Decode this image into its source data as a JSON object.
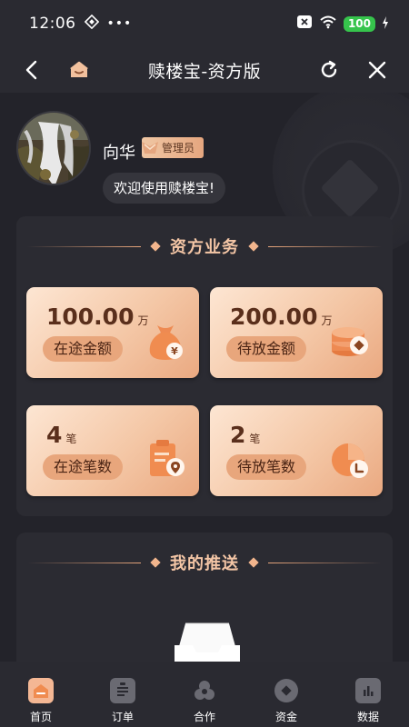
{
  "status_bar": {
    "time": "12:06",
    "battery": "100"
  },
  "header": {
    "title": "赎楼宝-资方版"
  },
  "profile": {
    "name": "向华",
    "role": "管理员",
    "welcome": "欢迎使用赎楼宝!"
  },
  "business": {
    "section_title": "资方业务",
    "cards": [
      {
        "value": "100.00",
        "unit": "万",
        "label": "在途金额",
        "icon": "money-bag-icon"
      },
      {
        "value": "200.00",
        "unit": "万",
        "label": "待放金额",
        "icon": "coin-stack-icon"
      },
      {
        "value": "4",
        "unit": "笔",
        "label": "在途笔数",
        "icon": "clipboard-location-icon"
      },
      {
        "value": "2",
        "unit": "笔",
        "label": "待放笔数",
        "icon": "pie-chart-icon"
      }
    ]
  },
  "push": {
    "section_title": "我的推送"
  },
  "tabbar": {
    "items": [
      {
        "label": "首页",
        "icon": "home-icon",
        "active": true
      },
      {
        "label": "订单",
        "icon": "order-list-icon",
        "active": false
      },
      {
        "label": "合作",
        "icon": "cooperation-icon",
        "active": false
      },
      {
        "label": "资金",
        "icon": "funds-icon",
        "active": false
      },
      {
        "label": "数据",
        "icon": "data-chart-icon",
        "active": false
      }
    ]
  },
  "colors": {
    "accent": "#e8a67c",
    "accent_light": "#f4c6a6",
    "background": "#23232a",
    "battery": "#36c44c"
  }
}
